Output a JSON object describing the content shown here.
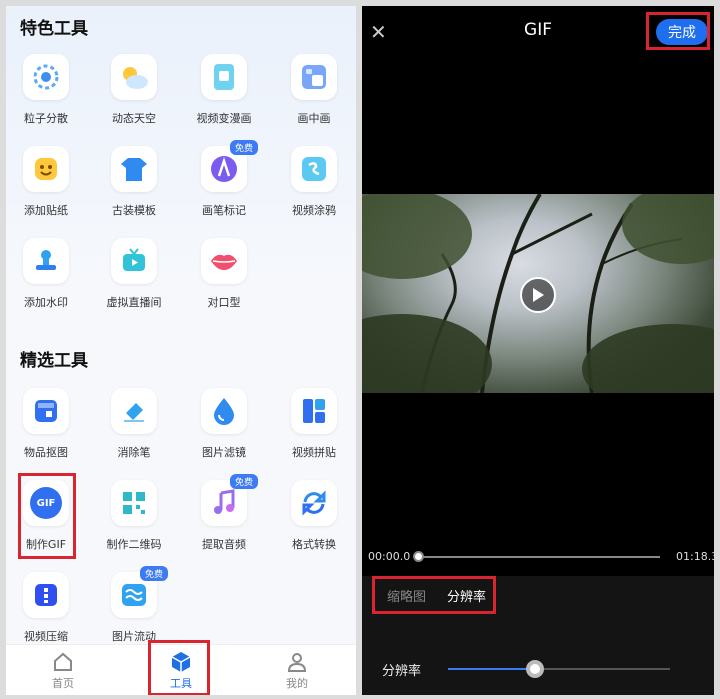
{
  "left": {
    "featured_title": "特色工具",
    "featured": [
      {
        "label": "粒子分散",
        "icon": "particle-icon"
      },
      {
        "label": "动态天空",
        "icon": "weather-icon"
      },
      {
        "label": "视频变漫画",
        "icon": "comic-icon"
      },
      {
        "label": "画中画",
        "icon": "picture-in-picture-icon"
      },
      {
        "label": "添加贴纸",
        "icon": "sticker-icon"
      },
      {
        "label": "古装模板",
        "icon": "costume-icon"
      },
      {
        "label": "画笔标记",
        "icon": "pen-mark-icon",
        "badge": "免费"
      },
      {
        "label": "视频涂鸦",
        "icon": "doodle-icon"
      },
      {
        "label": "添加水印",
        "icon": "stamp-icon"
      },
      {
        "label": "虚拟直播间",
        "icon": "tv-icon"
      },
      {
        "label": "对口型",
        "icon": "lips-icon"
      }
    ],
    "selected_title": "精选工具",
    "selected": [
      {
        "label": "物品抠图",
        "icon": "cutout-icon"
      },
      {
        "label": "消除笔",
        "icon": "eraser-icon"
      },
      {
        "label": "图片滤镜",
        "icon": "filter-drop-icon"
      },
      {
        "label": "视频拼贴",
        "icon": "collage-icon"
      },
      {
        "label": "制作GIF",
        "icon": "gif-icon",
        "icon_text": "GIF"
      },
      {
        "label": "制作二维码",
        "icon": "qr-code-icon"
      },
      {
        "label": "提取音频",
        "icon": "music-note-icon",
        "badge": "免费"
      },
      {
        "label": "格式转换",
        "icon": "convert-icon"
      },
      {
        "label": "视频压缩",
        "icon": "compress-icon"
      },
      {
        "label": "图片流动",
        "icon": "image-flow-icon",
        "badge": "免费"
      }
    ],
    "tabs": [
      {
        "label": "首页",
        "icon": "home-icon"
      },
      {
        "label": "工具",
        "icon": "cube-icon",
        "active": true
      },
      {
        "label": "我的",
        "icon": "profile-icon"
      }
    ]
  },
  "right": {
    "title": "GIF",
    "done_label": "完成",
    "time_start": "00:00.0",
    "time_end": "01:18.3",
    "segments": [
      "缩略图",
      "分辨率"
    ],
    "resolution_label": "分辨率",
    "resolution_level": 0.39
  },
  "colors": {
    "accent": "#1e6ff0",
    "highlight_box": "#d9252f"
  }
}
